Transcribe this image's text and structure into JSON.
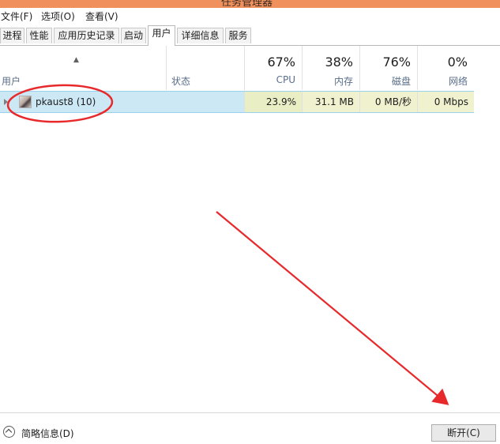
{
  "window": {
    "title": "任务管理器"
  },
  "menu": [
    "文件(F)",
    "选项(O)",
    "查看(V)"
  ],
  "tabs": [
    "进程",
    "性能",
    "应用历史记录",
    "启动",
    "用户",
    "详细信息",
    "服务"
  ],
  "active_tab": "用户",
  "columns": {
    "user": "用户",
    "status": "状态",
    "cpu": {
      "percent": "67%",
      "label": "CPU"
    },
    "memory": {
      "percent": "38%",
      "label": "内存"
    },
    "disk": {
      "percent": "76%",
      "label": "磁盘"
    },
    "network": {
      "percent": "0%",
      "label": "网络"
    }
  },
  "rows": [
    {
      "user": "pkaust8 (10)",
      "status": "",
      "cpu": "23.9%",
      "memory": "31.1 MB",
      "disk": "0 MB/秒",
      "network": "0 Mbps"
    }
  ],
  "footer": {
    "fewer_details": "简略信息(D)",
    "disconnect": "断开(C)"
  },
  "colors": {
    "titlebar": "#f0915d",
    "selection": "#cce8f5",
    "heat": "#e9eec5",
    "annotation": "#e8292b"
  },
  "icons": [
    "expand-arrow-icon",
    "user-avatar-icon",
    "sort-up-icon",
    "collapse-chevron-icon"
  ]
}
